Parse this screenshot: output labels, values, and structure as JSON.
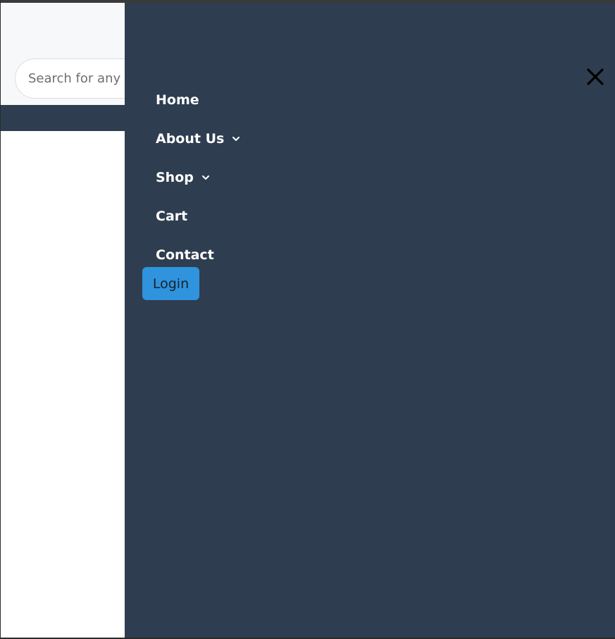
{
  "header": {
    "search": {
      "placeholder": "Search for any product"
    }
  },
  "drawer": {
    "close_icon": "close-icon",
    "menu": [
      {
        "label": "Home",
        "has_dropdown": false
      },
      {
        "label": "About Us",
        "has_dropdown": true
      },
      {
        "label": "Shop",
        "has_dropdown": true
      },
      {
        "label": "Cart",
        "has_dropdown": false
      },
      {
        "label": "Contact",
        "has_dropdown": false
      }
    ],
    "login_label": "Login"
  },
  "colors": {
    "drawer_bg": "#2e3d4f",
    "nav_band": "#2e3e50",
    "header_bg": "#f7f8fa",
    "login_bg": "#2f93dd",
    "menu_text": "#ffffff"
  }
}
